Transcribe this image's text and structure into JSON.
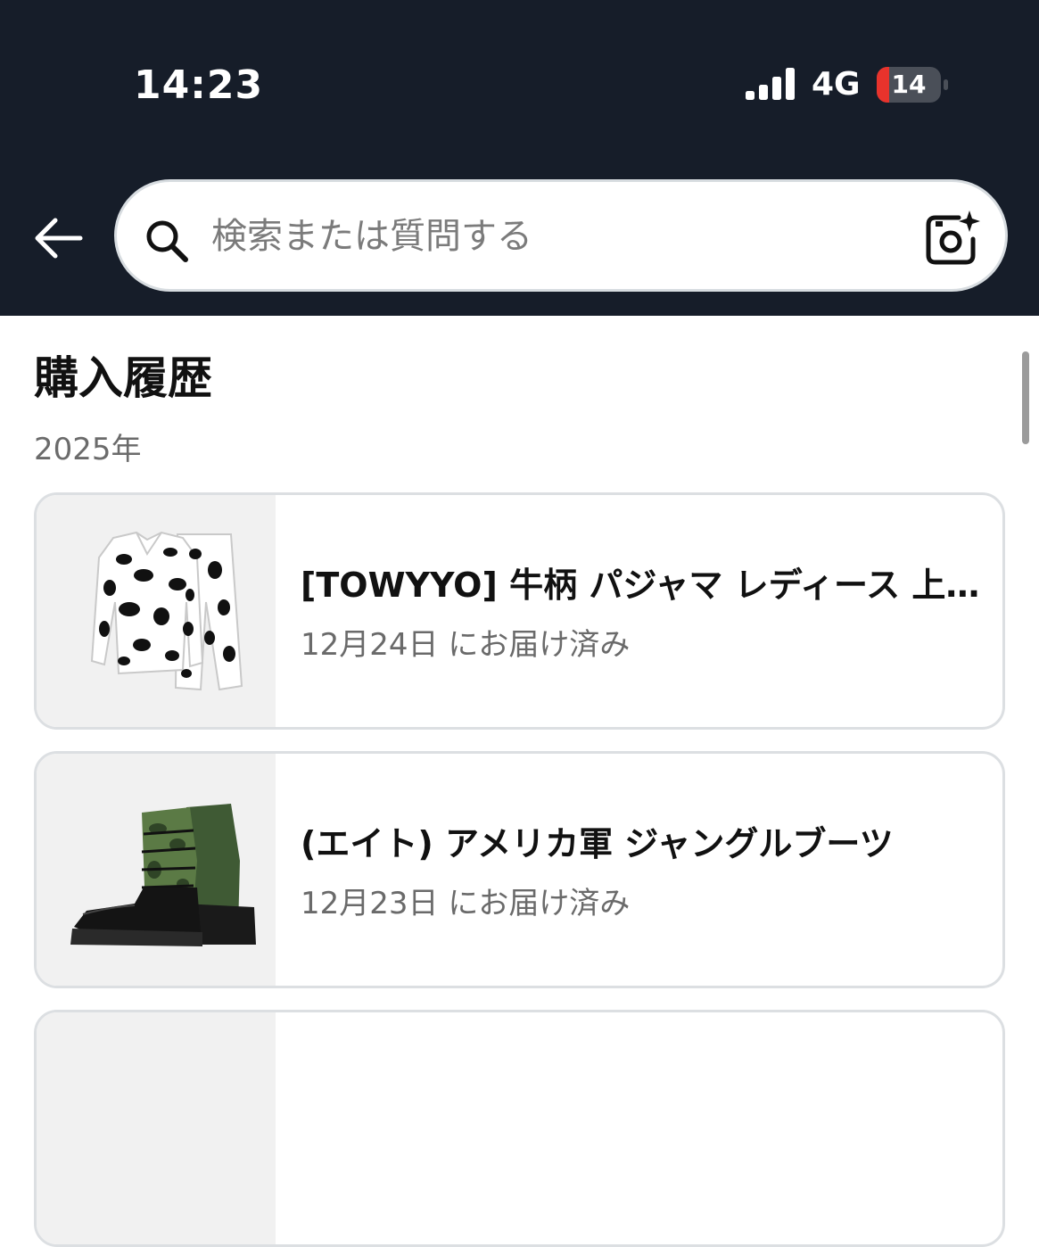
{
  "status_bar": {
    "time": "14:23",
    "network": "4G",
    "battery": "14"
  },
  "search": {
    "placeholder": "検索または質問する"
  },
  "page": {
    "title": "購入履歴",
    "year": "2025年"
  },
  "orders": [
    {
      "title": "[TOWYYO] 牛柄 パジャマ レディース 上下セット",
      "delivery": "12月24日 にお届け済み",
      "thumbnail": "cow-print-pajamas"
    },
    {
      "title": "(エイト) アメリカ軍 ジャングルブーツ",
      "delivery": "12月23日 にお届け済み",
      "thumbnail": "jungle-boots"
    }
  ],
  "colors": {
    "header_bg": "#161d29",
    "battery_low": "#e8332c"
  }
}
